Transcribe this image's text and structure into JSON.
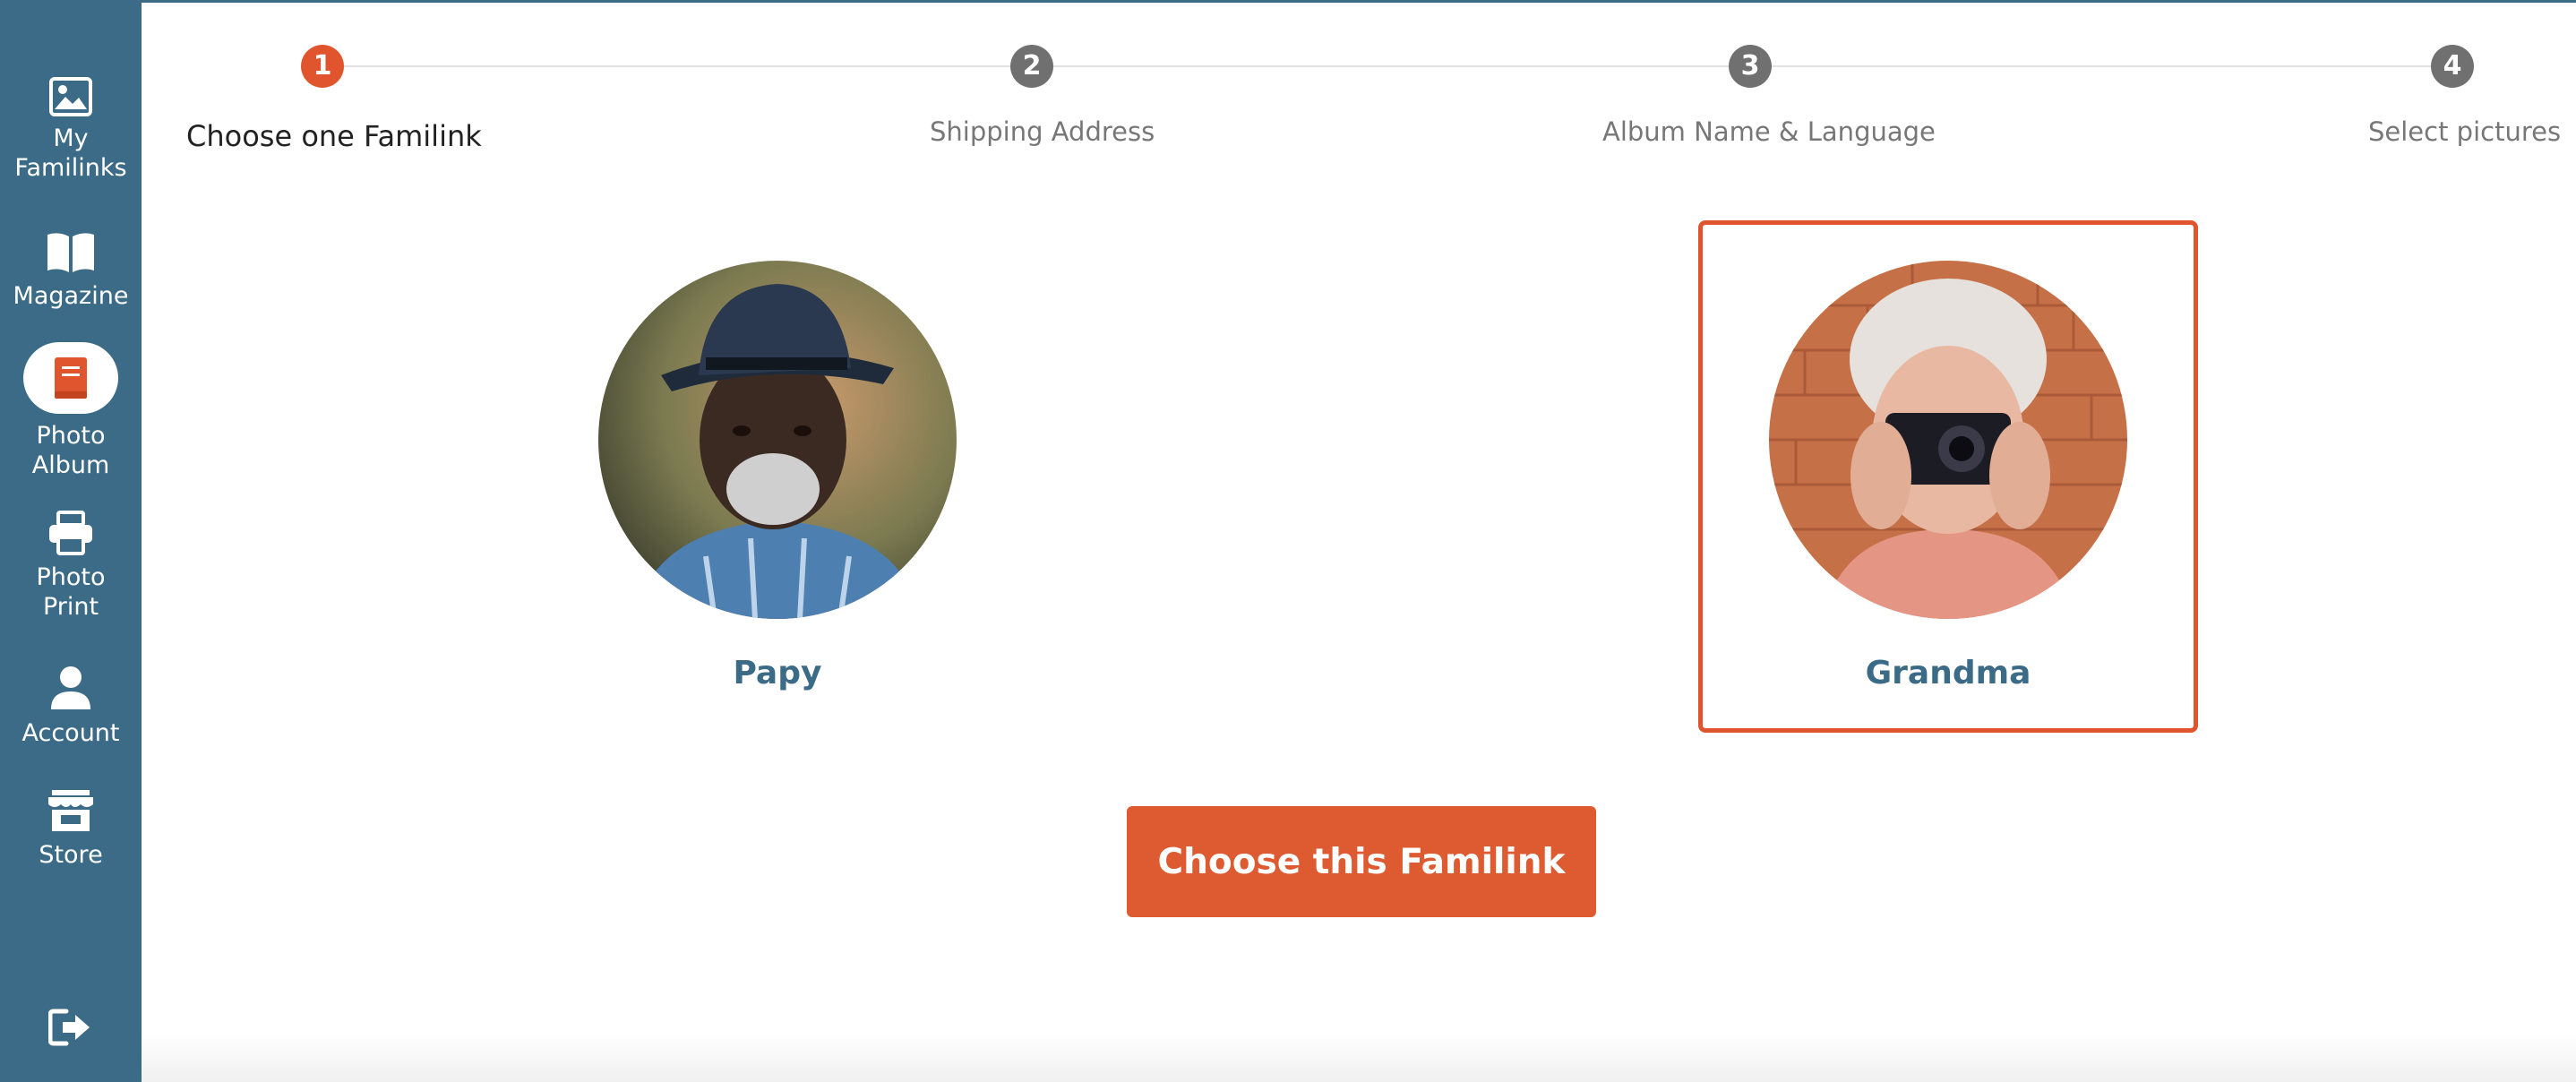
{
  "sidebar": {
    "items": [
      {
        "label": "My Familinks",
        "icon": "image-icon",
        "active": false
      },
      {
        "label": "Magazine",
        "icon": "book-open-icon",
        "active": false
      },
      {
        "label": "Photo Album",
        "icon": "album-icon",
        "active": true
      },
      {
        "label": "Photo Print",
        "icon": "printer-icon",
        "active": false
      },
      {
        "label": "Account",
        "icon": "user-icon",
        "active": false
      },
      {
        "label": "Store",
        "icon": "store-icon",
        "active": false
      }
    ],
    "logout_icon": "logout-icon"
  },
  "stepper": {
    "steps": [
      {
        "number": "1",
        "label": "Choose one Familink",
        "active": true
      },
      {
        "number": "2",
        "label": "Shipping Address",
        "active": false
      },
      {
        "number": "3",
        "label": "Album Name & Language",
        "active": false
      },
      {
        "number": "4",
        "label": "Select pictures",
        "active": false
      }
    ]
  },
  "familinks": [
    {
      "name": "Papy",
      "selected": false
    },
    {
      "name": "Grandma",
      "selected": true
    }
  ],
  "actions": {
    "choose_label": "Choose this Familink"
  },
  "colors": {
    "sidebar": "#3b6b86",
    "accent": "#e0552e",
    "step_inactive": "#707070",
    "name_text": "#3b6b86"
  }
}
